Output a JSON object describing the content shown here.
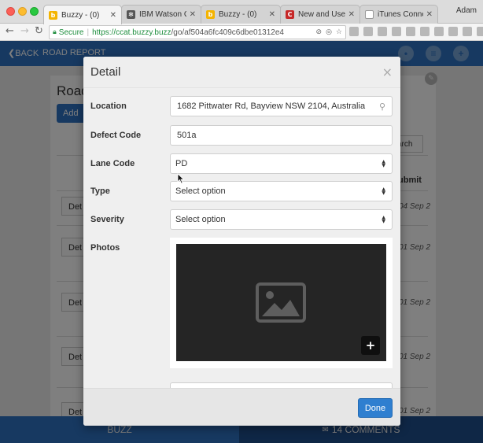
{
  "browser": {
    "tabs": [
      {
        "title": "Buzzy - (0)",
        "favicon": "buzzy-icon",
        "active": true
      },
      {
        "title": "IBM Watson Co",
        "favicon": "watson-icon",
        "active": false
      },
      {
        "title": "Buzzy - (0)",
        "favicon": "buzzy-icon",
        "active": false
      },
      {
        "title": "New and Used C",
        "favicon": "carsales-icon",
        "active": false
      },
      {
        "title": "iTunes Connect",
        "favicon": "page-icon",
        "active": false
      }
    ],
    "profile_name": "Adam",
    "secure_label": "Secure",
    "url_scheme": "https://",
    "url_host": "ccat.buzzy.buzz",
    "url_path": "/go/af504a6fc409c6dbe01312e4"
  },
  "app": {
    "back_label": "BACK",
    "title": "ROAD REPORT",
    "bg_heading": "Road",
    "bg_add_label": "Add",
    "bg_search_label": "arch",
    "bg_column_label": "ubmit",
    "bg_rows": [
      {
        "btn": "Det",
        "date": "04 Sep 2"
      },
      {
        "btn": "Det",
        "date": "01 Sep 2"
      },
      {
        "btn": "Det",
        "date": "01 Sep 2"
      },
      {
        "btn": "Det",
        "date": "01 Sep 2"
      },
      {
        "btn": "Det",
        "date": "01 Sep 2"
      }
    ],
    "bottom_tabs": {
      "buzz": "BUZZ",
      "comments": "14 COMMENTS"
    }
  },
  "modal": {
    "title": "Detail",
    "close_glyph": "×",
    "fields": {
      "location": {
        "label": "Location",
        "value": "1682 Pittwater Rd, Bayview NSW 2104, Australia"
      },
      "defect_code": {
        "label": "Defect Code",
        "value": "501a"
      },
      "lane_code": {
        "label": "Lane Code",
        "value": "PD"
      },
      "type": {
        "label": "Type",
        "value": "Select option"
      },
      "severity": {
        "label": "Severity",
        "value": "Select option"
      },
      "photos": {
        "label": "Photos"
      }
    },
    "done_label": "Done"
  },
  "colors": {
    "primary": "#2f73c2",
    "done_button": "#2f7fd0",
    "secure_green": "#1e8e3e"
  }
}
